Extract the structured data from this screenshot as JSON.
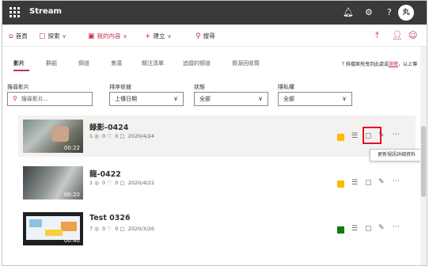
{
  "app": {
    "title": "Stream"
  },
  "topbar": {
    "icons": [
      "notification-bell-icon",
      "settings-gear-icon",
      "help-icon"
    ],
    "avatar_text": "丸"
  },
  "command_bar": {
    "items": [
      {
        "label": "首頁",
        "icon": "home-icon"
      },
      {
        "label": "探索",
        "icon": "explore-icon",
        "dropdown": true
      },
      {
        "label": "我的內容",
        "icon": "my-content-icon",
        "dropdown": true,
        "accent": true
      },
      {
        "label": "建立",
        "icon": "plus-icon",
        "dropdown": true
      },
      {
        "label": "搜尋",
        "icon": "search-icon"
      }
    ],
    "right_icons": [
      "upload-icon",
      "people-icon",
      "smiley-icon"
    ]
  },
  "tabs": {
    "items": [
      "影片",
      "群組",
      "頻道",
      "會議",
      "關注清單",
      "追蹤的頻道",
      "資源回收筒"
    ],
    "active": "影片",
    "hint_prefix": "將檔案拖曳到此處或",
    "hint_link": "瀏覽",
    "hint_suffix": "，以上傳"
  },
  "filters": {
    "search": {
      "label": "搜尋影片",
      "placeholder": "搜尋影片..."
    },
    "sort": {
      "label": "排序依據",
      "value": "上傳日期"
    },
    "status": {
      "label": "狀態",
      "value": "全部"
    },
    "privacy": {
      "label": "隱私權",
      "value": "全部"
    }
  },
  "videos": [
    {
      "title": "錄影-0424",
      "views": "1",
      "likes": "0",
      "comments": "0",
      "date": "2020/4/24",
      "duration": "00:22",
      "status_color": "#ffb900"
    },
    {
      "title": "龍-0422",
      "views": "1",
      "likes": "0",
      "comments": "0",
      "date": "2020/4/22",
      "duration": "00:20",
      "status_color": "#ffb900"
    },
    {
      "title": "Test 0326",
      "views": "7",
      "likes": "0",
      "comments": "0",
      "date": "2020/3/26",
      "duration": "00:40",
      "status_color": "#107c10"
    }
  ],
  "tooltip": "更新視訊詳細資料",
  "colors": {
    "accent": "#c4314b",
    "highlight_border": "#e81123"
  }
}
